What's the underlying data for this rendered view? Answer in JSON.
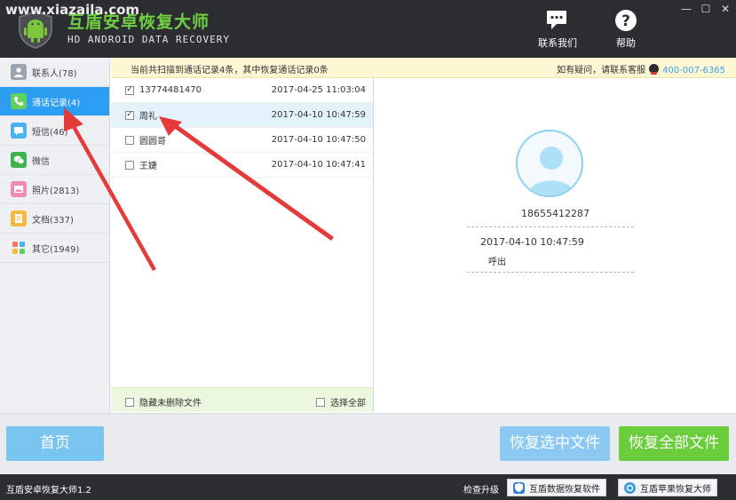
{
  "watermark": "www.xiazaila.com",
  "app": {
    "title": "互盾安卓恢复大师",
    "subtitle": "HD ANDROID DATA RECOVERY"
  },
  "toolbar": {
    "contact_label": "联系我们",
    "help_label": "帮助"
  },
  "sidebar": {
    "items": [
      {
        "label": "联系人(78)",
        "icon": "contacts-icon",
        "color": "#9aa4b0"
      },
      {
        "label": "通话记录(4)",
        "icon": "phone-icon",
        "color": "#5fd15f"
      },
      {
        "label": "短信(46)",
        "icon": "sms-icon",
        "color": "#49b3f0"
      },
      {
        "label": "微信",
        "icon": "wechat-icon",
        "color": "#3bb54a"
      },
      {
        "label": "照片(2813)",
        "icon": "photo-icon",
        "color": "#f28ab2"
      },
      {
        "label": "文档(337)",
        "icon": "document-icon",
        "color": "#f5b841"
      },
      {
        "label": "其它(1949)",
        "icon": "other-icon",
        "color": "#f27a5e"
      }
    ],
    "active_index": 1
  },
  "infobar": {
    "scan_summary": "当前共扫描到通话记录4条，其中恢复通话记录0条",
    "help_text": "如有疑问，请联系客服",
    "phone": "400-007-6365"
  },
  "records": [
    {
      "name": "13774481470",
      "time": "2017-04-25 11:03:04",
      "checked": true
    },
    {
      "name": "周礼",
      "time": "2017-04-10 10:47:59",
      "checked": true
    },
    {
      "name": "圆圆哥",
      "time": "2017-04-10 10:47:50",
      "checked": false
    },
    {
      "name": "王婕",
      "time": "2017-04-10 10:47:41",
      "checked": false
    }
  ],
  "list_footer": {
    "hide_label": "隐藏未删除文件",
    "select_all_label": "选择全部"
  },
  "detail": {
    "number": "18655412287",
    "time": "2017-04-10 10:47:59",
    "type": "呼出"
  },
  "actions": {
    "home_label": "首页",
    "recover_selected_label": "恢复选中文件",
    "recover_all_label": "恢复全部文件"
  },
  "statusbar": {
    "version": "互盾安卓恢复大师1.2",
    "upgrade": "检查升级",
    "product1": "互盾数据恢复软件",
    "product2": "互盾苹果恢复大师"
  },
  "colors": {
    "accent_blue": "#2b9ef2",
    "accent_green": "#6acd3b",
    "annotation_red": "#e53a3a"
  }
}
